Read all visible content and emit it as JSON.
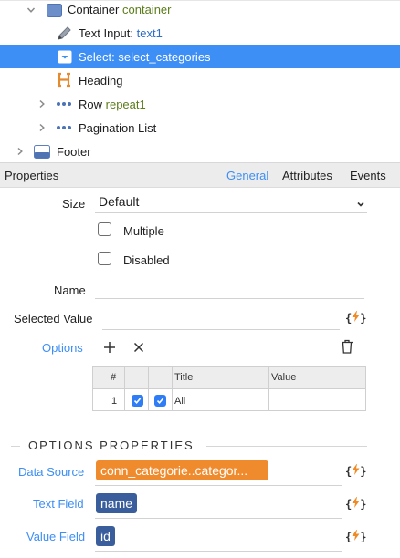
{
  "tree": {
    "rows": [
      {
        "name": "Container",
        "id": "container"
      },
      {
        "name": "Text Input:",
        "id": "text1"
      },
      {
        "name": "Select:",
        "id": "select_categories"
      },
      {
        "name": "Heading"
      },
      {
        "name": "Row",
        "id": "repeat1"
      },
      {
        "name": "Pagination List"
      },
      {
        "name": "Footer"
      }
    ]
  },
  "properties": {
    "title": "Properties",
    "tabs": [
      "General",
      "Attributes",
      "Events"
    ],
    "active_tab": "General",
    "size_label": "Size",
    "size_value": "Default",
    "multiple_label": "Multiple",
    "multiple_checked": false,
    "disabled_label": "Disabled",
    "disabled_checked": false,
    "name_label": "Name",
    "name_value": "",
    "selected_value_label": "Selected Value",
    "selected_value": "",
    "options_label": "Options",
    "fx_open": "{",
    "fx_close": "}"
  },
  "options_table": {
    "columns": [
      "#",
      "",
      "",
      "Title",
      "Value"
    ],
    "rows": [
      {
        "num": "1",
        "checked1": true,
        "checked2": true,
        "title": "All",
        "value": ""
      }
    ]
  },
  "options_properties": {
    "section_title": "OPTIONS PROPERTIES",
    "data_source_label": "Data Source",
    "data_source_value": "conn_categorie..categor...",
    "text_field_label": "Text Field",
    "text_field_value": "name",
    "value_field_label": "Value Field",
    "value_field_value": "id"
  },
  "colors": {
    "selection": "#3d8ef5",
    "link": "#3d8ef5",
    "chip_orange": "#ef8a2d",
    "chip_navy": "#3a5e9c",
    "bolt": "#f08a24"
  }
}
